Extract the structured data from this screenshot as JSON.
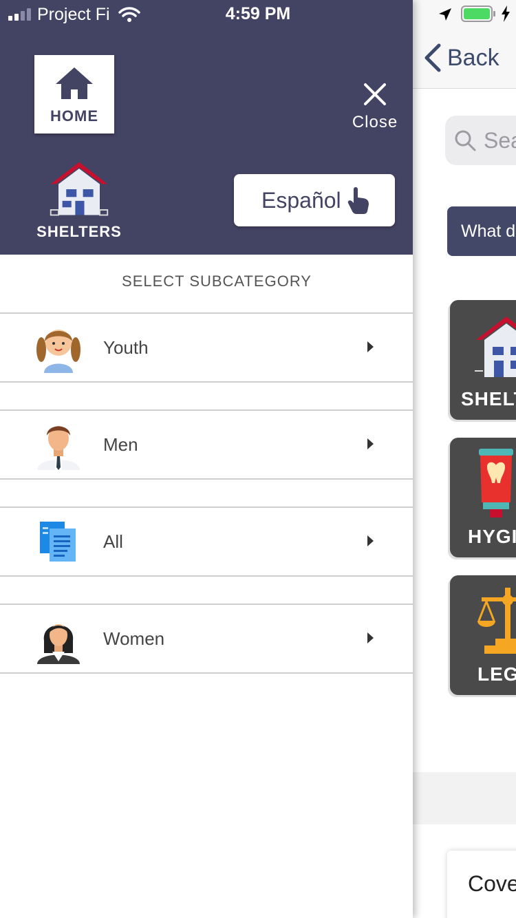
{
  "status_bar": {
    "carrier": "Project Fi",
    "time": "4:59 PM"
  },
  "drawer": {
    "home_label": "HOME",
    "close_label": "Close",
    "shelters_label": "SHELTERS",
    "language_button": "Español",
    "subcategory_title": "SELECT SUBCATEGORY",
    "items": [
      {
        "label": "Youth",
        "icon": "girl-avatar-icon"
      },
      {
        "label": "Men",
        "icon": "man-avatar-icon"
      },
      {
        "label": "All",
        "icon": "documents-icon"
      },
      {
        "label": "Women",
        "icon": "woman-avatar-icon"
      }
    ]
  },
  "background_screen": {
    "back_label": "Back",
    "search_placeholder": "Sea",
    "question_button": "What d",
    "categories": [
      {
        "label": "SHELT",
        "icon": "house-icon"
      },
      {
        "label": "HYGI",
        "icon": "toothpaste-icon"
      },
      {
        "label": "LEG",
        "icon": "scales-icon"
      }
    ],
    "cover_text": "Cove"
  },
  "colors": {
    "drawer_header": "#434363",
    "card_bg": "#4a4a4a",
    "accent_text": "#434363",
    "battery": "#4cd964"
  }
}
